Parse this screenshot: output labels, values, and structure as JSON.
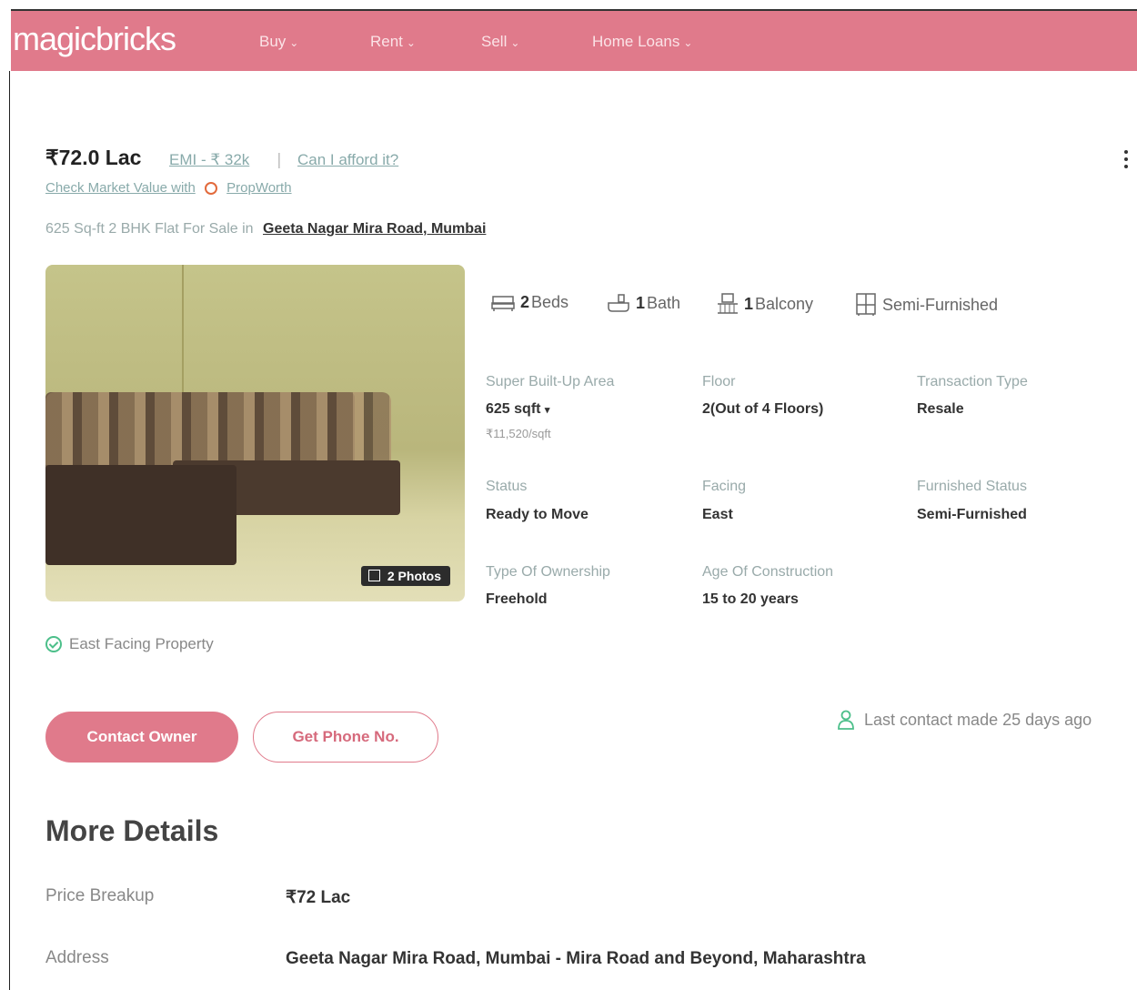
{
  "header": {
    "logo": "magicbricks",
    "nav": [
      {
        "label": "Buy"
      },
      {
        "label": "Rent"
      },
      {
        "label": "Sell"
      },
      {
        "label": "Home Loans"
      }
    ],
    "color": "#e07a8b"
  },
  "listing": {
    "price": "₹72.0 Lac",
    "emi": "EMI - ₹ 32k",
    "separator": "|",
    "afford": "Can I afford it?",
    "market_value": "Check Market Value with",
    "propworth": "PropWorth",
    "title_prefix": "625 Sq-ft 2 BHK Flat For Sale in",
    "location": "Geeta Nagar Mira Road, Mumbai",
    "photos_badge": "2 Photos",
    "amenities": [
      {
        "count": "2",
        "label": "Beds",
        "icon": "bed-icon"
      },
      {
        "count": "1",
        "label": "Bath",
        "icon": "bath-icon"
      },
      {
        "count": "1",
        "label": "Balcony",
        "icon": "balcony-icon"
      },
      {
        "count": "",
        "label": "Semi-Furnished",
        "icon": "furniture-icon"
      }
    ],
    "details": {
      "super_area_label": "Super Built-Up Area",
      "super_area_value": "625 sqft",
      "super_area_rate": "₹11,520/sqft",
      "floor_label": "Floor",
      "floor_value": "2(Out of 4 Floors)",
      "transaction_label": "Transaction Type",
      "transaction_value": "Resale",
      "status_label": "Status",
      "status_value": "Ready to Move",
      "facing_label": "Facing",
      "facing_value": "East",
      "furnished_label": "Furnished Status",
      "furnished_value": "Semi-Furnished",
      "ownership_label": "Type Of Ownership",
      "ownership_value": "Freehold",
      "age_label": "Age Of Construction",
      "age_value": "15 to 20 years"
    },
    "facing_note": "East Facing Property",
    "contact_button": "Contact Owner",
    "phone_button": "Get Phone No.",
    "last_contact": "Last contact made 25 days ago"
  },
  "more_details": {
    "title": "More Details",
    "price_breakup_label": "Price Breakup",
    "price_breakup_value": "₹72 Lac",
    "address_label": "Address",
    "address_value": "Geeta Nagar Mira Road, Mumbai - Mira Road and Beyond, Maharashtra"
  }
}
